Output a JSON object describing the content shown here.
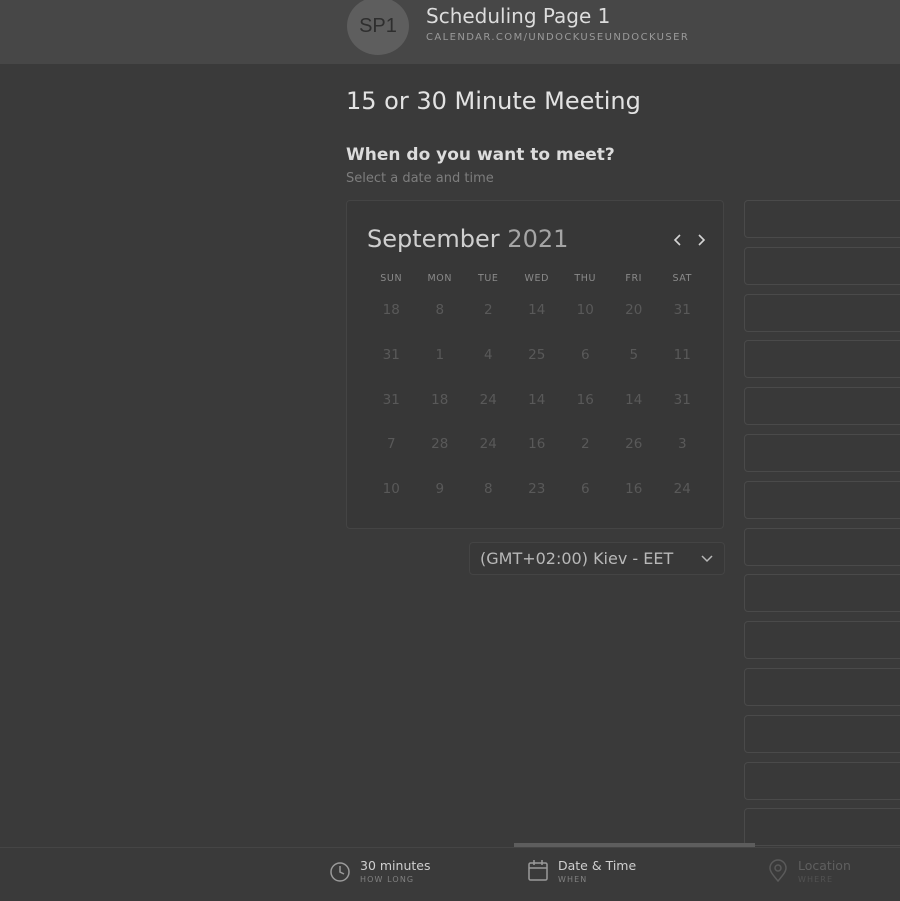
{
  "header": {
    "avatar_initials": "SP1",
    "page_name": "Scheduling Page 1",
    "page_url": "CALENDAR.COM/UNDOCKUSEUNDOCKUSER"
  },
  "meeting": {
    "title": "15 or 30 Minute Meeting",
    "question": "When do you want to meet?",
    "subtitle": "Select a date and time"
  },
  "calendar": {
    "month": "September",
    "year": "2021",
    "prev_icon": "chevron-left-icon",
    "next_icon": "chevron-right-icon",
    "weekdays": [
      "SUN",
      "MON",
      "TUE",
      "WED",
      "THU",
      "FRI",
      "SAT"
    ],
    "weeks": [
      [
        "18",
        "8",
        "2",
        "14",
        "10",
        "20",
        "31"
      ],
      [
        "31",
        "1",
        "4",
        "25",
        "6",
        "5",
        "11"
      ],
      [
        "31",
        "18",
        "24",
        "14",
        "16",
        "14",
        "31"
      ],
      [
        "7",
        "28",
        "24",
        "16",
        "2",
        "26",
        "3"
      ],
      [
        "10",
        "9",
        "8",
        "23",
        "6",
        "16",
        "24"
      ]
    ]
  },
  "timezone": {
    "value": "(GMT+02:00) Kiev - EET",
    "icon": "chevron-down-icon"
  },
  "time_slots_count_visible": 14,
  "footer": {
    "steps": [
      {
        "label": "30 minutes",
        "sub": "HOW LONG",
        "icon": "clock-icon"
      },
      {
        "label": "Date & Time",
        "sub": "WHEN",
        "icon": "calendar-icon"
      },
      {
        "label": "Location",
        "sub": "WHERE",
        "icon": "location-pin-icon"
      }
    ]
  }
}
